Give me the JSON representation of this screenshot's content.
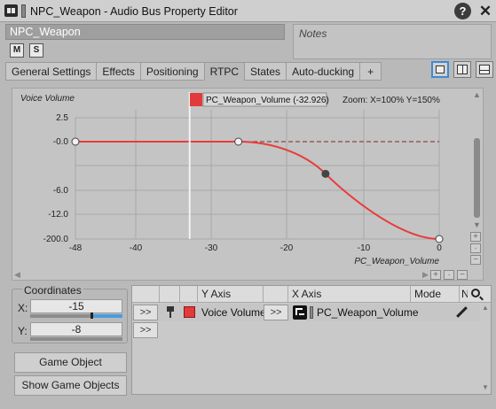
{
  "window": {
    "title": "NPC_Weapon - Audio Bus Property Editor",
    "help_label": "?",
    "close_label": "✕"
  },
  "object": {
    "name": "NPC_Weapon",
    "mute_label": "M",
    "solo_label": "S",
    "notes_placeholder": "Notes"
  },
  "tabs": [
    {
      "label": "General Settings",
      "active": false
    },
    {
      "label": "Effects",
      "active": false
    },
    {
      "label": "Positioning",
      "active": false
    },
    {
      "label": "RTPC",
      "active": true
    },
    {
      "label": "States",
      "active": false
    },
    {
      "label": "Auto-ducking",
      "active": false
    },
    {
      "label": "+",
      "active": false
    }
  ],
  "graph": {
    "y_axis_title": "Voice Volume",
    "x_axis_title": "PC_Weapon_Volume",
    "cursor_label": "PC_Weapon_Volume (-32.926)",
    "zoom_text": "Zoom: X=100% Y=150%",
    "y_ticks": [
      "2.5",
      "-0.0",
      "-6.0",
      "-12.0",
      "-200.0"
    ],
    "x_ticks": [
      "-48",
      "-40",
      "-30",
      "-20",
      "-10",
      "0"
    ],
    "curve_color": "#ea3b3b",
    "cursor_x_value": -32.926,
    "points": [
      {
        "x": -48,
        "y": 0
      },
      {
        "x": -26.5,
        "y": 0
      },
      {
        "x": -15,
        "y": -8
      },
      {
        "x": 0,
        "y": -200
      }
    ]
  },
  "coordinates": {
    "legend": "Coordinates",
    "x_label": "X:",
    "x_value": "-15",
    "x_fraction": 0.69,
    "y_label": "Y:",
    "y_value": "-8"
  },
  "buttons": {
    "game_object_explorer": "Game Object Explorer...",
    "show_game_objects": "Show Game Objects"
  },
  "rtpc_table": {
    "columns": [
      "Y Axis",
      "X Axis",
      "Mode",
      "N"
    ],
    "expand_label": ">>",
    "rows": [
      {
        "y_axis": "Voice Volume",
        "x_axis": "PC_Weapon_Volume",
        "color": "#e23b3b"
      }
    ]
  }
}
